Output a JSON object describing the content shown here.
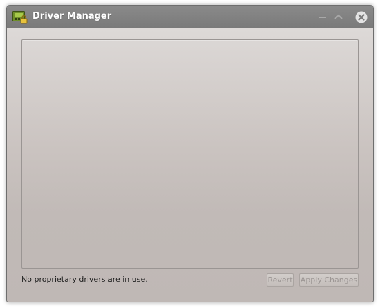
{
  "window": {
    "title": "Driver Manager",
    "icon": "driver-manager-icon",
    "controls": [
      "minimize-icon",
      "maximize-icon",
      "close-icon"
    ]
  },
  "main": {
    "status_text": "No proprietary drivers are in use.",
    "revert_label": "Revert",
    "apply_label": "Apply Changes",
    "revert_enabled": false,
    "apply_enabled": false
  },
  "colors": {
    "titlebar": "#7f7f7f",
    "window_bg": "#c9c3c0",
    "disabled_text": "#9c9694"
  }
}
